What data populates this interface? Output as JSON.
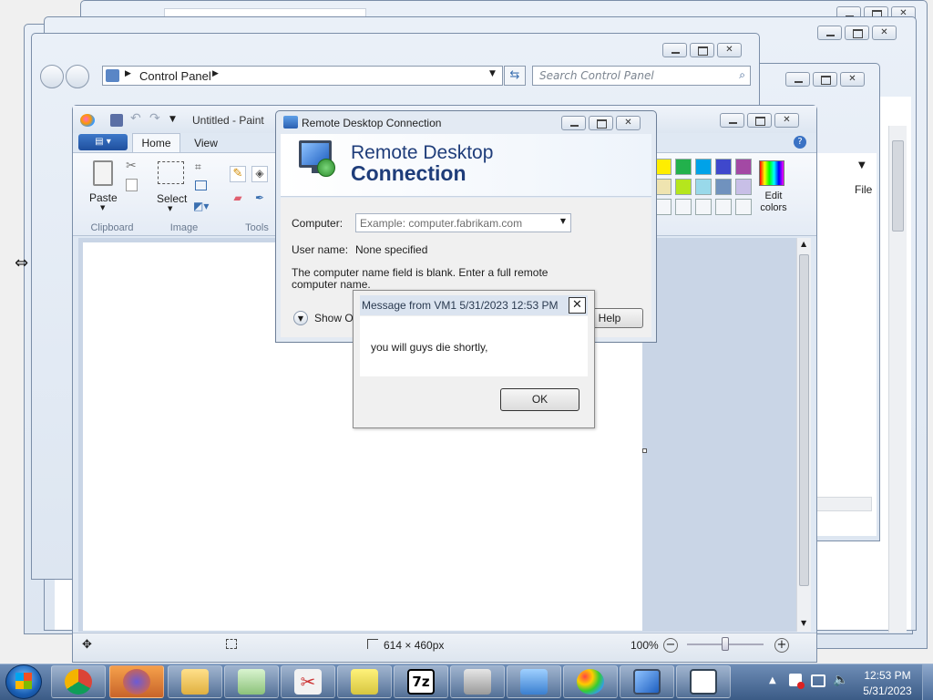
{
  "control_panel": {
    "breadcrumb": "Control Panel",
    "search_placeholder": "Search Control Panel"
  },
  "paint": {
    "title": "Untitled - Paint",
    "tabs": [
      "Home",
      "View"
    ],
    "groups": {
      "clipboard": "Clipboard",
      "image": "Image",
      "tools": "Tools"
    },
    "paste_label": "Paste",
    "select_label": "Select",
    "edit_colors_label": "Edit colors",
    "canvas_size": "614 × 460px",
    "zoom": "100%",
    "right_panel_label": "File",
    "palette_colors": [
      "#ffee00",
      "#22b14c",
      "#00a2e8",
      "#3f48cc",
      "#a349a4",
      "#efe4b0",
      "#b5e61d",
      "#99d9ea",
      "#7092be",
      "#c8bfe7"
    ]
  },
  "rdc": {
    "window_title": "Remote Desktop Connection",
    "banner_line1": "Remote Desktop",
    "banner_line2": "Connection",
    "computer_label": "Computer:",
    "computer_placeholder": "Example: computer.fabrikam.com",
    "username_label": "User name:",
    "username_value": "None specified",
    "warning": "The computer name field is blank. Enter a full remote computer name.",
    "show_options": "Show Op",
    "help": "Help"
  },
  "message": {
    "title": "Message from VM1 5/31/2023 12:53 PM",
    "body": "you will guys die shortly,",
    "ok": "OK"
  },
  "taskbar": {
    "time": "12:53 PM",
    "date": "5/31/2023"
  }
}
